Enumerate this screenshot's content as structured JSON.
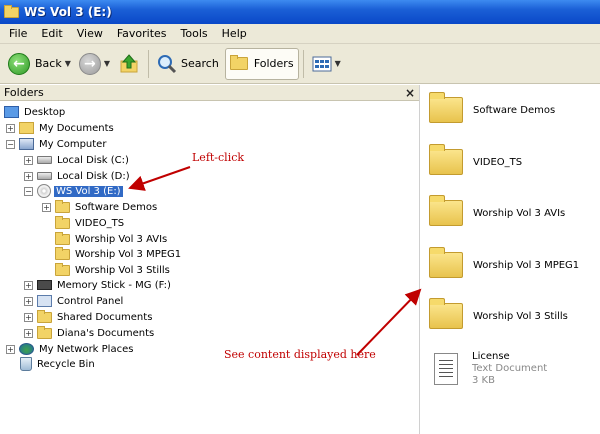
{
  "window": {
    "title": "WS Vol 3 (E:)"
  },
  "menu": [
    "File",
    "Edit",
    "View",
    "Favorites",
    "Tools",
    "Help"
  ],
  "toolbar": {
    "back_label": "Back",
    "search_label": "Search",
    "folders_label": "Folders"
  },
  "folders_panel": {
    "header": "Folders",
    "close": "×",
    "tree": [
      {
        "label": "Desktop",
        "icon": "desktop-icon"
      },
      {
        "label": "My Documents",
        "icon": "my-documents-icon",
        "expander": "+"
      },
      {
        "label": "My Computer",
        "icon": "computer-icon",
        "expander": "−"
      },
      {
        "label": "Local Disk (C:)",
        "icon": "drive-icon",
        "expander": "+"
      },
      {
        "label": "Local Disk (D:)",
        "icon": "drive-icon",
        "expander": "+"
      },
      {
        "label": "WS Vol 3 (E:)",
        "icon": "cd-drive-icon",
        "expander": "−",
        "selected": true
      },
      {
        "label": "Software Demos",
        "icon": "folder-icon",
        "expander": "+"
      },
      {
        "label": "VIDEO_TS",
        "icon": "folder-icon"
      },
      {
        "label": "Worship Vol 3 AVIs",
        "icon": "folder-icon"
      },
      {
        "label": "Worship Vol 3 MPEG1",
        "icon": "folder-icon"
      },
      {
        "label": "Worship Vol 3 Stills",
        "icon": "folder-icon"
      },
      {
        "label": "Memory Stick - MG (F:)",
        "icon": "memory-stick-icon",
        "expander": "+"
      },
      {
        "label": "Control Panel",
        "icon": "control-panel-icon",
        "expander": "+"
      },
      {
        "label": "Shared Documents",
        "icon": "folder-icon",
        "expander": "+"
      },
      {
        "label": "Diana's Documents",
        "icon": "folder-icon",
        "expander": "+"
      },
      {
        "label": "My Network Places",
        "icon": "network-icon",
        "expander": "+"
      },
      {
        "label": "Recycle Bin",
        "icon": "recycle-bin-icon"
      }
    ]
  },
  "annotations": {
    "left_click": "Left-click",
    "see_content": "See content displayed here"
  },
  "content": {
    "folders": [
      "Software Demos",
      "VIDEO_TS",
      "Worship Vol 3 AVIs",
      "Worship Vol 3 MPEG1",
      "Worship Vol 3 Stills"
    ],
    "file": {
      "name": "License",
      "type": "Text Document",
      "size": "3 KB"
    }
  },
  "colors": {
    "titlebar": "#0a48c8",
    "selection": "#316ac5",
    "annotation": "#c00000",
    "chrome": "#ece9d8"
  }
}
